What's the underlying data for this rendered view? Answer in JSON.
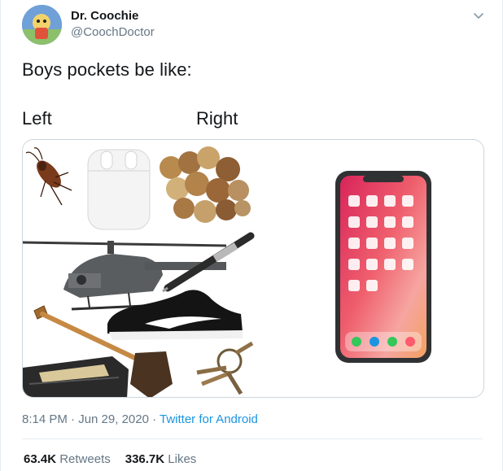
{
  "tweet": {
    "author_name": "Dr. Coochie",
    "author_handle": "@CoochDoctor",
    "text": "Boys pockets be like:",
    "label_left": "Left",
    "label_right": "Right",
    "media_icons": [
      "cockroach-icon",
      "airpods-icon",
      "coins-icon",
      "helicopter-icon",
      "pen-icon",
      "sneaker-icon",
      "shovel-icon",
      "wallet-icon",
      "keys-icon",
      "smartphone-icon"
    ],
    "timestamp": "8:14 PM · Jun 29, 2020",
    "separator": " · ",
    "source_app": "Twitter for Android",
    "retweets_count": "63.4K",
    "retweets_label": "Retweets",
    "likes_count": "336.7K",
    "likes_label": "Likes"
  },
  "colors": {
    "text_primary": "#14171a",
    "text_secondary": "#657786",
    "link": "#1b95e0",
    "border": "#ccd6dd"
  }
}
